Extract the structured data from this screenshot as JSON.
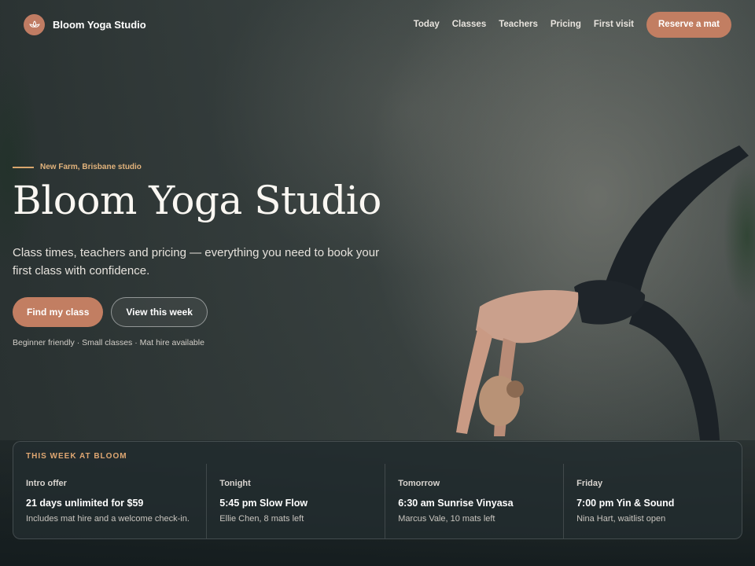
{
  "brand": {
    "name": "Bloom Yoga Studio",
    "icon": "lotus-icon",
    "accent": "#c27e62"
  },
  "nav": {
    "links": [
      "Today",
      "Classes",
      "Teachers",
      "Pricing",
      "First visit"
    ],
    "cta_label": "Reserve a mat"
  },
  "hero": {
    "kicker": "New Farm, Brisbane studio",
    "title": "Bloom Yoga Studio",
    "subtitle": "Class times, teachers and pricing — everything you need to book your first class with confidence.",
    "primary_cta": "Find my class",
    "secondary_cta": "View this week",
    "note": "Beginner friendly · Small classes · Mat hire available"
  },
  "week": {
    "heading": "THIS WEEK AT BLOOM",
    "columns": [
      {
        "label": "Intro offer",
        "main": "21 days unlimited for $59",
        "detail": "Includes mat hire and a welcome check-in."
      },
      {
        "label": "Tonight",
        "main": "5:45 pm Slow Flow",
        "detail": "Ellie Chen, 8 mats left"
      },
      {
        "label": "Tomorrow",
        "main": "6:30 am Sunrise Vinyasa",
        "detail": "Marcus Vale, 10 mats left"
      },
      {
        "label": "Friday",
        "main": "7:00 pm Yin & Sound",
        "detail": "Nina Hart, waitlist open"
      }
    ]
  }
}
